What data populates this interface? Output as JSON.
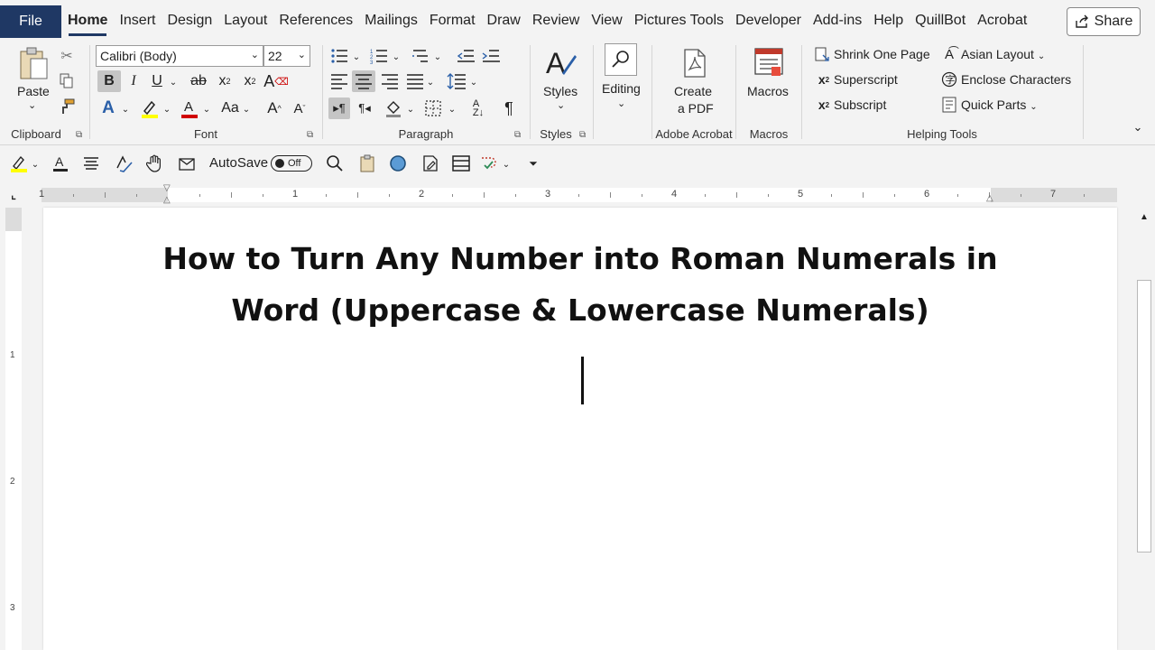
{
  "menubar": {
    "file": "File",
    "tabs": [
      "Home",
      "Insert",
      "Design",
      "Layout",
      "References",
      "Mailings",
      "Format",
      "Draw",
      "Review",
      "View",
      "Pictures Tools",
      "Developer",
      "Add-ins",
      "Help",
      "QuillBot",
      "Acrobat"
    ],
    "share": "Share"
  },
  "ribbon": {
    "clipboard": {
      "label": "Clipboard",
      "paste": "Paste"
    },
    "font": {
      "label": "Font",
      "name": "Calibri (Body)",
      "size": "22"
    },
    "paragraph": {
      "label": "Paragraph"
    },
    "styles": {
      "label": "Styles",
      "button": "Styles"
    },
    "editing": {
      "button": "Editing"
    },
    "adobe": {
      "label": "Adobe Acrobat",
      "line1": "Create",
      "line2": "a PDF"
    },
    "macros": {
      "label": "Macros",
      "button": "Macros"
    },
    "helping": {
      "label": "Helping Tools",
      "shrink": "Shrink One Page",
      "superscript": "Superscript",
      "subscript": "Subscript",
      "asian": "Asian Layout",
      "enclose": "Enclose Characters",
      "quickparts": "Quick Parts"
    }
  },
  "qat": {
    "autosave": "AutoSave",
    "toggle": "Off"
  },
  "ruler": {
    "numbers": [
      "1",
      "1",
      "2",
      "3",
      "4",
      "5",
      "6",
      "7"
    ]
  },
  "vruler": {
    "numbers": [
      "1",
      "2",
      "3"
    ]
  },
  "document": {
    "title_line1": "How to Turn Any Number into Roman Numerals in",
    "title_line2": "Word (Uppercase & Lowercase Numerals)"
  }
}
